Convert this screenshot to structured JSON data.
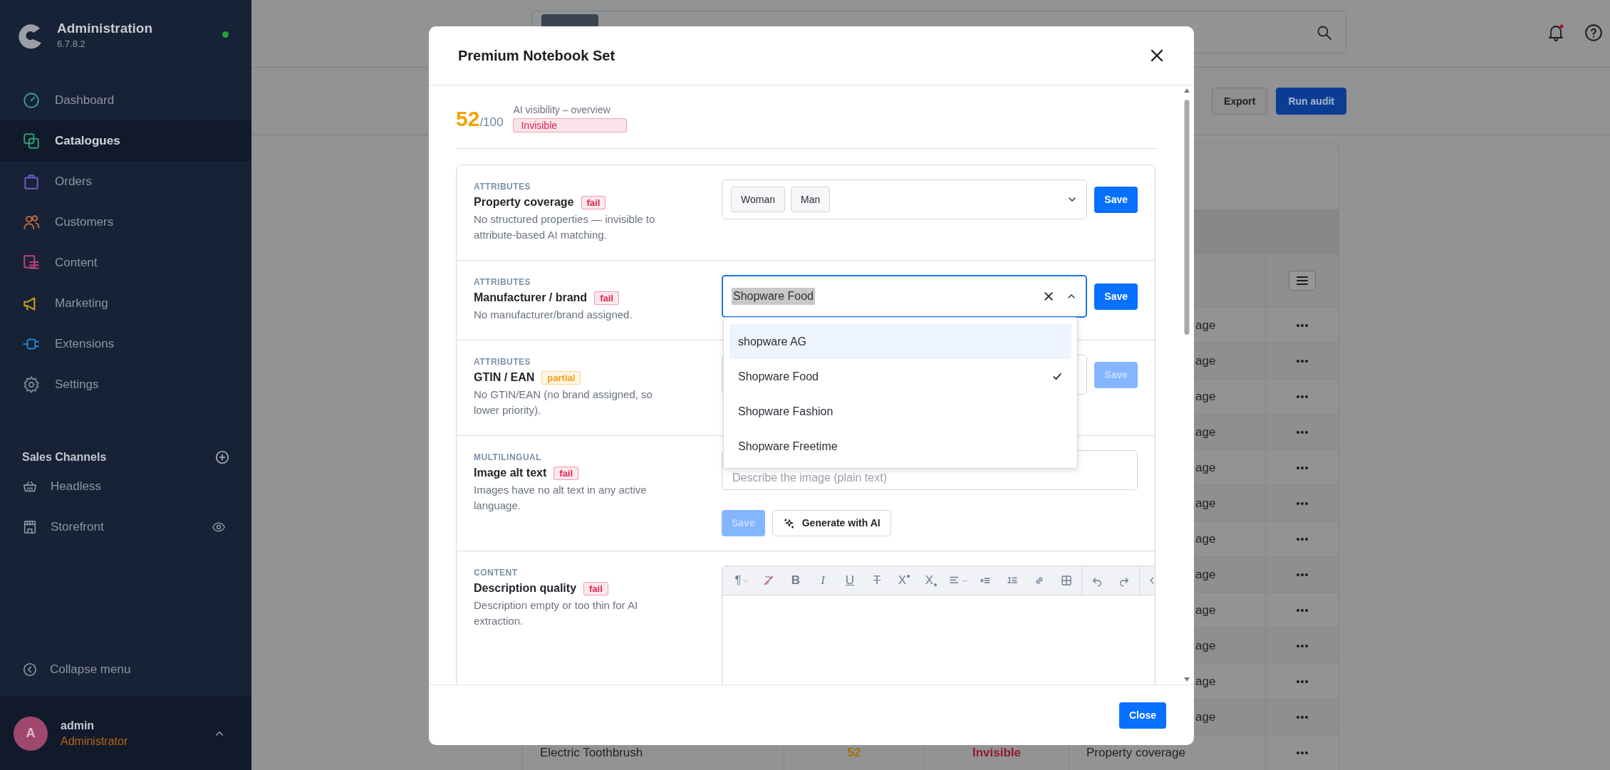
{
  "sidebar": {
    "title": "Administration",
    "version": "6.7.8.2",
    "online": true,
    "nav": [
      {
        "label": "Dashboard",
        "selected": false,
        "color": "#3d93a6"
      },
      {
        "label": "Catalogues",
        "selected": true,
        "color": "#2f9e72"
      },
      {
        "label": "Orders",
        "selected": false,
        "color": "#6a5ec4"
      },
      {
        "label": "Customers",
        "selected": false,
        "color": "#c8693b"
      },
      {
        "label": "Content",
        "selected": false,
        "color": "#c2417f"
      },
      {
        "label": "Marketing",
        "selected": false,
        "color": "#c9a21b"
      },
      {
        "label": "Extensions",
        "selected": false,
        "color": "#2186d0"
      },
      {
        "label": "Settings",
        "selected": false,
        "color": "#7b8391"
      }
    ],
    "sales_channels": {
      "heading": "Sales Channels",
      "items": [
        {
          "label": "Headless",
          "preview": false
        },
        {
          "label": "Storefront",
          "preview": true
        }
      ]
    },
    "collapse": "Collapse menu",
    "user": {
      "initial": "A",
      "name": "admin",
      "role": "Administrator"
    }
  },
  "header": {
    "notifications": true
  },
  "toolbar": {
    "buttons": [
      {
        "label": "Export",
        "kind": "secondary"
      },
      {
        "label": "Run audit",
        "kind": "primary"
      }
    ]
  },
  "table": {
    "rows": [
      {
        "column_4": "age"
      },
      {
        "column_4": "age"
      },
      {
        "column_4": "age"
      },
      {
        "column_4": "age"
      },
      {
        "column_4": "age"
      },
      {
        "column_4": "age"
      },
      {
        "column_4": "age"
      },
      {
        "column_4": "age"
      },
      {
        "column_4": "age"
      },
      {
        "column_4": "age"
      },
      {
        "column_4": "age"
      },
      {
        "column_4": "age"
      },
      {
        "column_1": "Electric Toothbrush",
        "column_2": "52",
        "column_3": "Invisible",
        "column_4": "Property coverage"
      }
    ]
  },
  "modal": {
    "title": "Premium Notebook Set",
    "score": "52",
    "score_max": "/100",
    "overview": "AI visibility – overview",
    "status": {
      "text": "Invisible",
      "color": "#e0234e"
    },
    "checks": [
      {
        "category": "ATTRIBUTES",
        "title": "Property coverage",
        "badge": {
          "text": "fail",
          "color": "#e0234e"
        },
        "description": "No structured properties — invisible to attribute-based AI matching.",
        "control": {
          "kind": "multiselect",
          "tags": [
            "Woman",
            "Man"
          ],
          "expanded": false
        },
        "buttons": [
          {
            "label": "Save",
            "kind": "primary",
            "disabled": false
          }
        ]
      },
      {
        "category": "ATTRIBUTES",
        "title": "Manufacturer / brand",
        "badge": {
          "text": "fail",
          "color": "#e0234e"
        },
        "description": "No manufacturer/brand assigned.",
        "control": {
          "kind": "select",
          "value": "Shopware Food",
          "text_selected": true,
          "focused": true,
          "expanded": true,
          "options": [
            {
              "label": "shopware AG",
              "selected": false,
              "hovered": true
            },
            {
              "label": "Shopware Food",
              "selected": true,
              "hovered": false
            },
            {
              "label": "Shopware Fashion",
              "selected": false,
              "hovered": false
            },
            {
              "label": "Shopware Freetime",
              "selected": false,
              "hovered": false
            }
          ]
        },
        "buttons": [
          {
            "label": "Save",
            "kind": "primary",
            "disabled": false
          }
        ]
      },
      {
        "category": "ATTRIBUTES",
        "title": "GTIN / EAN",
        "badge": {
          "text": "partial",
          "color": "#f59e0b"
        },
        "description": "No GTIN/EAN (no brand assigned, so lower priority).",
        "control": {
          "kind": "input"
        },
        "buttons": [
          {
            "label": "Save",
            "kind": "primary",
            "disabled": true
          }
        ]
      },
      {
        "category": "MULTILINGUAL",
        "title": "Image alt text",
        "badge": {
          "text": "fail",
          "color": "#e0234e"
        },
        "description": "Images have no alt text in any active language.",
        "control": {
          "kind": "textarea",
          "placeholder": "Describe the image (plain text)"
        },
        "buttons": [
          {
            "label": "Save",
            "kind": "primary",
            "disabled": true
          },
          {
            "label": "Generate with AI",
            "kind": "ai",
            "disabled": false
          }
        ]
      },
      {
        "category": "CONTENT",
        "title": "Description quality",
        "badge": {
          "text": "fail",
          "color": "#e0234e"
        },
        "description": "Description empty or too thin for AI extraction.",
        "control": {
          "kind": "editor",
          "toolbar": [
            {
              "kind": "paragraph",
              "text": "¶",
              "caret": true
            },
            {
              "kind": "clear"
            },
            {
              "kind": "bold",
              "text": "B"
            },
            {
              "kind": "italic",
              "text": "I"
            },
            {
              "kind": "underline",
              "text": "U"
            },
            {
              "kind": "strike",
              "text": "T"
            },
            {
              "kind": "sup",
              "text": "X"
            },
            {
              "kind": "sub",
              "text": "X"
            },
            {
              "kind": "align",
              "caret": true
            },
            {
              "kind": "bullets"
            },
            {
              "kind": "numbers"
            },
            {
              "kind": "link"
            },
            {
              "kind": "table"
            },
            {
              "kind": "divider"
            },
            {
              "kind": "undo"
            },
            {
              "kind": "redo"
            },
            {
              "kind": "divider"
            },
            {
              "kind": "code"
            }
          ]
        }
      }
    ],
    "close_label": "Close"
  }
}
